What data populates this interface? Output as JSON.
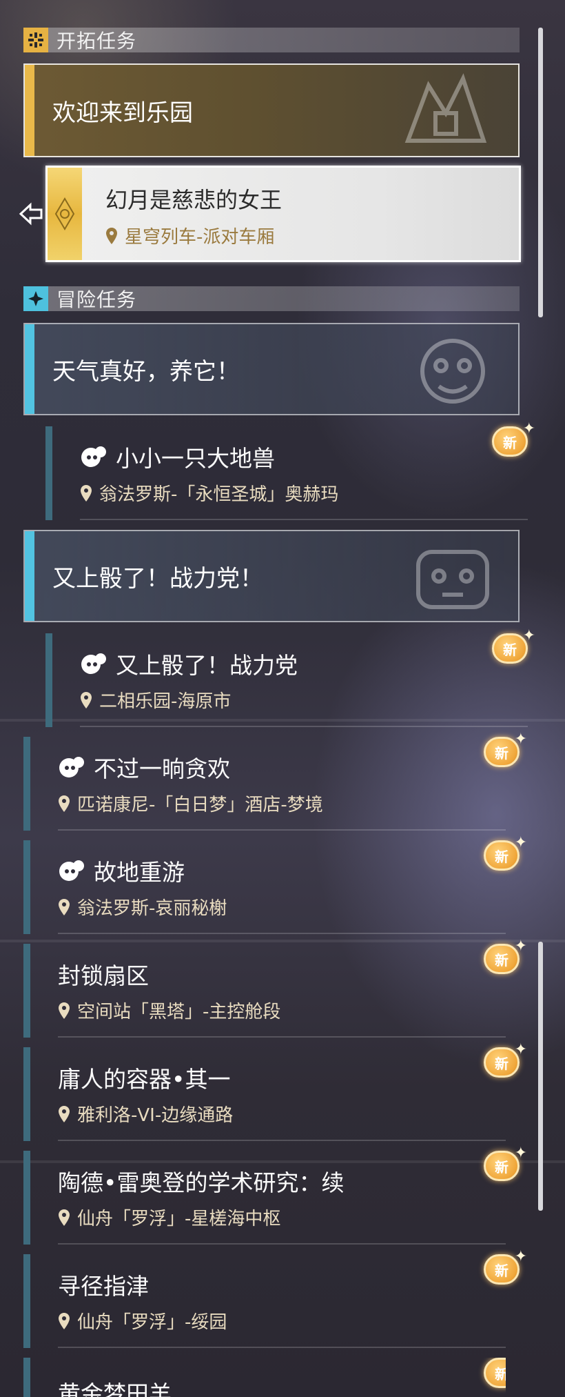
{
  "trailblaze": {
    "header": "开拓任务",
    "group_title": "欢迎来到乐园",
    "selected_quest": {
      "title": "幻月是慈悲的女王",
      "location": "星穹列车-派对车厢"
    }
  },
  "adventure": {
    "header": "冒险任务",
    "groups": [
      {
        "title": "天气真好，养它！"
      },
      {
        "title": "又上骰了！战力党！"
      }
    ],
    "quests": [
      {
        "title": "小小一只大地兽",
        "location": "翁法罗斯-「永恒圣城」奥赫玛",
        "badge": "新"
      },
      {
        "title": "又上骰了！战力党",
        "location": "二相乐园-海原市",
        "badge": "新"
      },
      {
        "title": "不过一晌贪欢",
        "location": "匹诺康尼-「白日梦」酒店-梦境",
        "badge": "新"
      },
      {
        "title": "故地重游",
        "location": "翁法罗斯-哀丽秘榭",
        "badge": "新"
      },
      {
        "title": "封锁扇区",
        "location": "空间站「黑塔」-主控舱段",
        "badge": "新"
      },
      {
        "title": "庸人的容器•其一",
        "location": "雅利洛-VI-边缘通路",
        "badge": "新"
      },
      {
        "title": "陶德•雷奥登的学术研究：续",
        "location": "仙舟「罗浮」-星槎海中枢",
        "badge": "新"
      },
      {
        "title": "寻径指津",
        "location": "仙舟「罗浮」-绥园",
        "badge": "新"
      },
      {
        "title": "黄金梦田羊",
        "location": "",
        "badge": "新"
      }
    ]
  },
  "colors": {
    "trail_accent": "#e9b94a",
    "adventure_accent": "#52c3e1",
    "badge": "#f0a73b"
  },
  "icons": [
    "trailblaze-icon",
    "adventure-icon",
    "map-pin-icon",
    "pom-pom-icon",
    "new-badge-icon",
    "selected-arrow-icon"
  ]
}
